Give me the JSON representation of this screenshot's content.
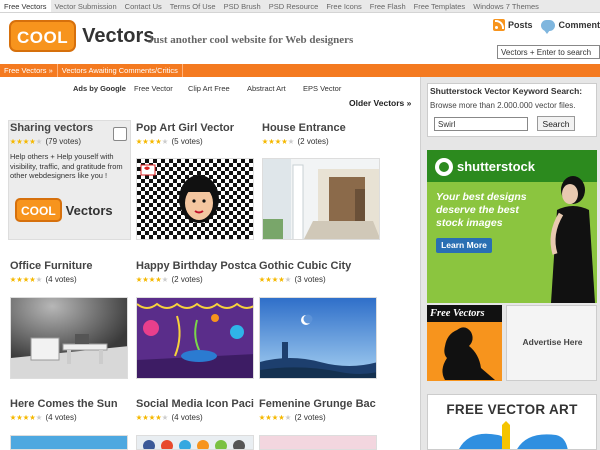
{
  "topnav": [
    "Free Vectors",
    "Vector Submission",
    "Contact Us",
    "Terms Of Use",
    "PSD Brush",
    "PSD Resource",
    "Free Icons",
    "Free Flash",
    "Free Templates",
    "Windows 7 Themes"
  ],
  "header": {
    "logo_cool": "COOL",
    "logo_vectors": "Vectors",
    "tagline": "Just another cool website for Web designers",
    "posts_label": "Posts",
    "comments_label": "Comment",
    "search_value": "Vectors + Enter to search"
  },
  "subnav": [
    "Free Vectors »",
    "Vectors Awaiting Comments/Critics"
  ],
  "ad_links": [
    "Ads by Google",
    "Free Vector",
    "Clip Art Free",
    "Abstract Art",
    "EPS Vector"
  ],
  "older_vectors": "Older Vectors »",
  "share": {
    "title": "Sharing vectors",
    "votes": "(79 votes)",
    "rating": 4,
    "description": "Help others + Help youself with visibility, traffic, and gratitude from other webdesigners like you !",
    "logo_cool": "COOL",
    "logo_vectors": "Vectors"
  },
  "cards": [
    {
      "title": "Pop Art Girl Vector",
      "votes": "(5 votes)",
      "rating": 4
    },
    {
      "title": "House Entrance",
      "votes": "(2 votes)",
      "rating": 4
    },
    {
      "title": "Office Furniture",
      "votes": "(4 votes)",
      "rating": 4
    },
    {
      "title": "Happy Birthday Postca",
      "votes": "(2 votes)",
      "rating": 4
    },
    {
      "title": "Gothic Cubic City",
      "votes": "(3 votes)",
      "rating": 4
    },
    {
      "title": "Here Comes the Sun",
      "votes": "(4 votes)",
      "rating": 4
    },
    {
      "title": "Social Media Icon Paci",
      "votes": "(4 votes)",
      "rating": 4
    },
    {
      "title": "Femenine Grunge Bac",
      "votes": "(2 votes)",
      "rating": 4
    }
  ],
  "sidebar": {
    "kw_title": "Shutterstock Vector Keyword Search:",
    "kw_desc": "Browse more than 2.000.000 vector files.",
    "kw_value": "Swirl",
    "kw_button": "Search",
    "ad_brand": "shutterstock",
    "ad_slogan": "Your best designs deserve the best stock images",
    "ad_button": "Learn More",
    "fv_label": "Free Vectors",
    "advertise": "Advertise Here",
    "fva_title": "FREE VECTOR ART"
  },
  "colors": {
    "accent": "#f47a20",
    "logo_orange": "#f7941d",
    "sidebar_bg": "#e6e6e6",
    "star": "#f5b800"
  }
}
